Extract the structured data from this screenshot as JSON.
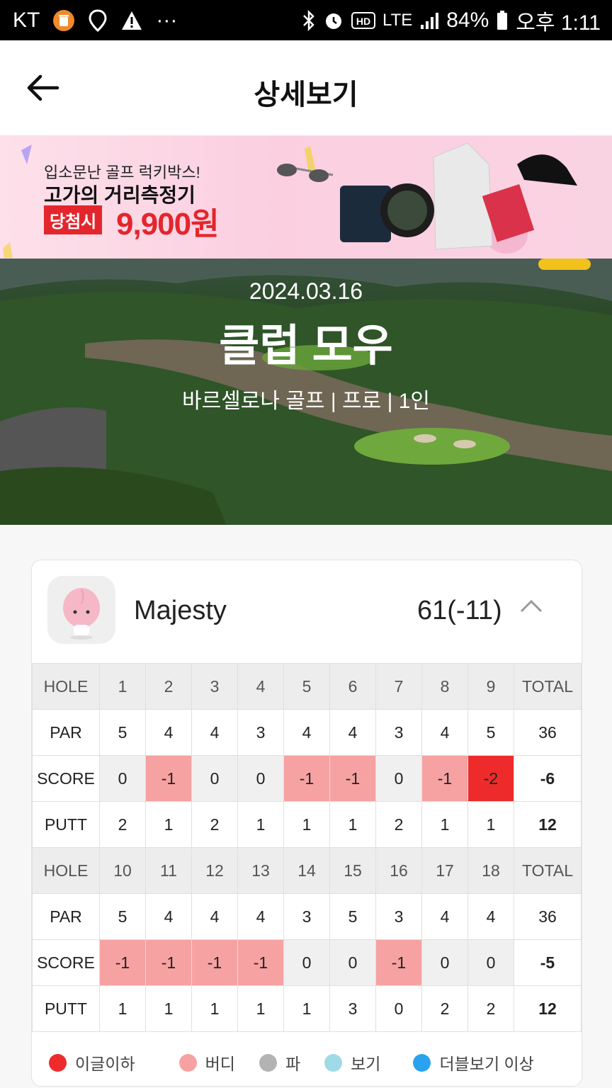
{
  "status_bar": {
    "carrier": "KT",
    "network": "LTE",
    "battery": "84%",
    "time": "오후 1:11",
    "more": "···"
  },
  "header": {
    "title": "상세보기"
  },
  "banner": {
    "line1": "입소문난 골프 럭키박스!",
    "line2": "고가의 거리측정기",
    "badge": "당첨시",
    "price": "9,900원"
  },
  "round": {
    "date": "2024.03.16",
    "club": "클럽 모우",
    "course": "바르셀로나 골프",
    "level": "프로",
    "players": "1인"
  },
  "player": {
    "name": "Majesty",
    "score": "61(-11)"
  },
  "scorecard": {
    "front": {
      "hole_label": "HOLE",
      "holes": [
        "1",
        "2",
        "3",
        "4",
        "5",
        "6",
        "7",
        "8",
        "9"
      ],
      "total_label": "TOTAL",
      "par_label": "PAR",
      "par": [
        "5",
        "4",
        "4",
        "3",
        "4",
        "4",
        "3",
        "4",
        "5"
      ],
      "par_total": "36",
      "score_label": "SCORE",
      "score": [
        "0",
        "-1",
        "0",
        "0",
        "-1",
        "-1",
        "0",
        "-1",
        "-2"
      ],
      "score_total": "-6",
      "putt_label": "PUTT",
      "putt": [
        "2",
        "1",
        "2",
        "1",
        "1",
        "1",
        "2",
        "1",
        "1"
      ],
      "putt_total": "12"
    },
    "back": {
      "hole_label": "HOLE",
      "holes": [
        "10",
        "11",
        "12",
        "13",
        "14",
        "15",
        "16",
        "17",
        "18"
      ],
      "total_label": "TOTAL",
      "par_label": "PAR",
      "par": [
        "5",
        "4",
        "4",
        "4",
        "3",
        "5",
        "3",
        "4",
        "4"
      ],
      "par_total": "36",
      "score_label": "SCORE",
      "score": [
        "-1",
        "-1",
        "-1",
        "-1",
        "0",
        "0",
        "-1",
        "0",
        "0"
      ],
      "score_total": "-5",
      "putt_label": "PUTT",
      "putt": [
        "1",
        "1",
        "1",
        "1",
        "1",
        "3",
        "0",
        "2",
        "2"
      ],
      "putt_total": "12"
    }
  },
  "legend": [
    {
      "label": "이글이하",
      "color": "#ee2b2b"
    },
    {
      "label": "버디",
      "color": "#f6a2a2"
    },
    {
      "label": "파",
      "color": "#b3b3b3"
    },
    {
      "label": "보기",
      "color": "#9fdbe6"
    },
    {
      "label": "더블보기 이상",
      "color": "#2aa3ef"
    }
  ]
}
